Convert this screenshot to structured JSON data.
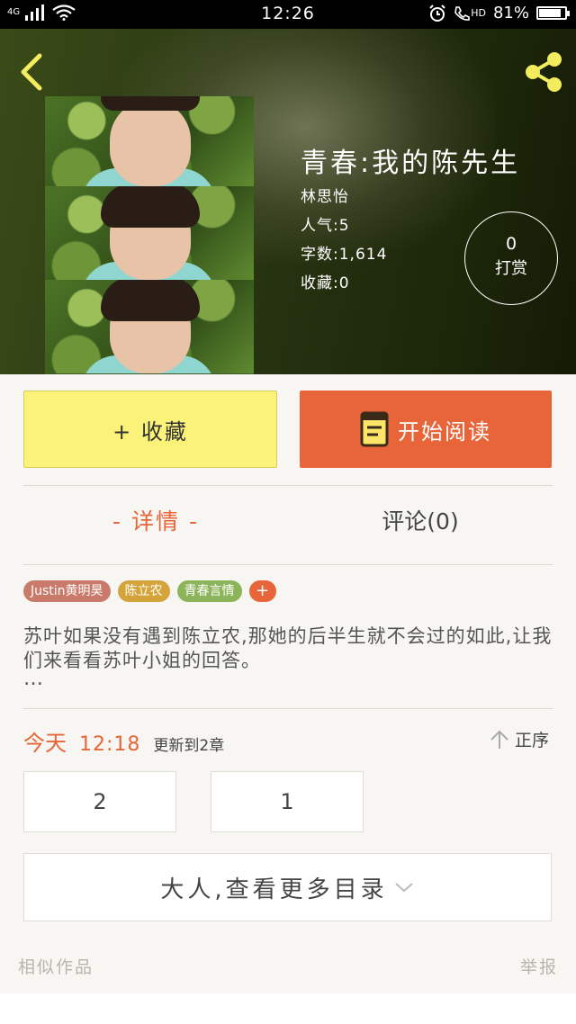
{
  "status_bar": {
    "network": "4G",
    "time": "12:26",
    "hd_label": "HD",
    "battery": "81%"
  },
  "book": {
    "title": "青春:我的陈先生",
    "author": "林思怡",
    "popularity": "人气:5",
    "word_count": "字数:1,614",
    "favorites": "收藏:0"
  },
  "tip": {
    "count": "0",
    "label": "打赏"
  },
  "actions": {
    "collect_label": "+ 收藏",
    "read_label": "开始阅读"
  },
  "tabs": {
    "details": "- 详情 -",
    "comments": "评论(0)"
  },
  "tags": [
    {
      "label": "Justin黄明昊",
      "color": "#c97a6a"
    },
    {
      "label": "陈立农",
      "color": "#d4a43a"
    },
    {
      "label": "青春言情",
      "color": "#8cb45a"
    }
  ],
  "tag_add_label": "+",
  "synopsis": "苏叶如果没有遇到陈立农,那她的后半生就不会过的如此,让我们来看看苏叶小姐的回答。",
  "synopsis_more": "…",
  "update": {
    "today": "今天",
    "time": "12:18",
    "text": "更新到2章"
  },
  "sort_label": "正序",
  "chapters": [
    "2",
    "1"
  ],
  "more_catalog_label": "大人,查看更多目录",
  "footer": {
    "similar": "相似作品",
    "report": "举报"
  },
  "colors": {
    "accent": "#e8653a",
    "collect_bg": "#fbf27a"
  }
}
